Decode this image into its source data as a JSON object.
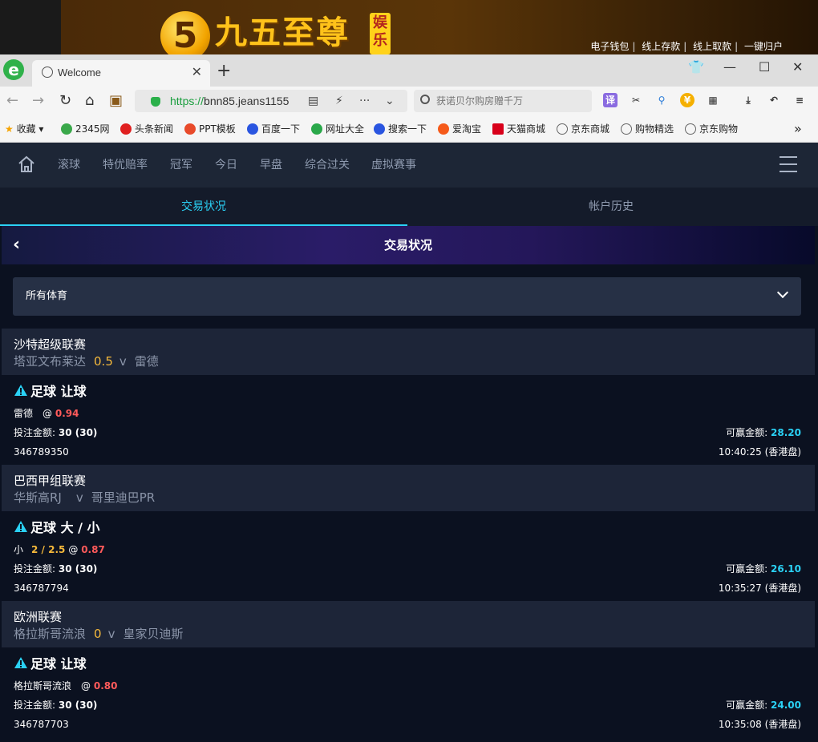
{
  "banner": {
    "logo_digit": "5",
    "logo_text": "九五至尊",
    "logo_tag": "娱乐",
    "links": [
      "电子钱包",
      "线上存款",
      "线上取款",
      "一键归户"
    ]
  },
  "browser": {
    "logo_glyph": "e",
    "tab_title": "Welcome",
    "url_scheme": "https://",
    "url_host": "bnn85.jeans1155",
    "search_placeholder": "获诺贝尔购房赠千万",
    "translate_label": "译",
    "bookmarks": [
      "收藏",
      "2345网",
      "头条新闻",
      "PPT模板",
      "百度一下",
      "网址大全",
      "搜索一下",
      "爱淘宝",
      "天猫商城",
      "京东商城",
      "购物精选",
      "京东购物"
    ]
  },
  "nav": {
    "items": [
      "滚球",
      "特优赔率",
      "冠军",
      "今日",
      "早盘",
      "综合过关",
      "虚拟赛事"
    ]
  },
  "subtabs": {
    "active": "交易状况",
    "inactive": "帐户历史"
  },
  "page": {
    "title": "交易状况",
    "sport_filter": "所有体育"
  },
  "labels": {
    "stake": "投注金额:",
    "win": "可赢金额:",
    "at": "@"
  },
  "bets": [
    {
      "league": "沙特超级联赛",
      "home": "塔亚文布莱达",
      "handicap": "0.5",
      "vs": "v",
      "away": "雷德",
      "type": "足球 让球",
      "selection": "雷德",
      "selection_line": "",
      "odds": "0.94",
      "stake": "30 (30)",
      "win": "28.20",
      "bet_id": "346789350",
      "time": "10:40:25 (香港盘)"
    },
    {
      "league": "巴西甲组联赛",
      "home": "华斯高RJ",
      "handicap": "",
      "vs": "v",
      "away": "哥里迪巴PR",
      "type": "足球 大 / 小",
      "selection": "小",
      "selection_line": "2 / 2.5",
      "odds": "0.87",
      "stake": "30 (30)",
      "win": "26.10",
      "bet_id": "346787794",
      "time": "10:35:27 (香港盘)"
    },
    {
      "league": "欧洲联赛",
      "home": "格拉斯哥流浪",
      "handicap": "0",
      "vs": "v",
      "away": "皇家贝迪斯",
      "type": "足球 让球",
      "selection": "格拉斯哥流浪",
      "selection_line": "",
      "odds": "0.80",
      "stake": "30 (30)",
      "win": "24.00",
      "bet_id": "346787703",
      "time": "10:35:08 (香港盘)"
    }
  ]
}
